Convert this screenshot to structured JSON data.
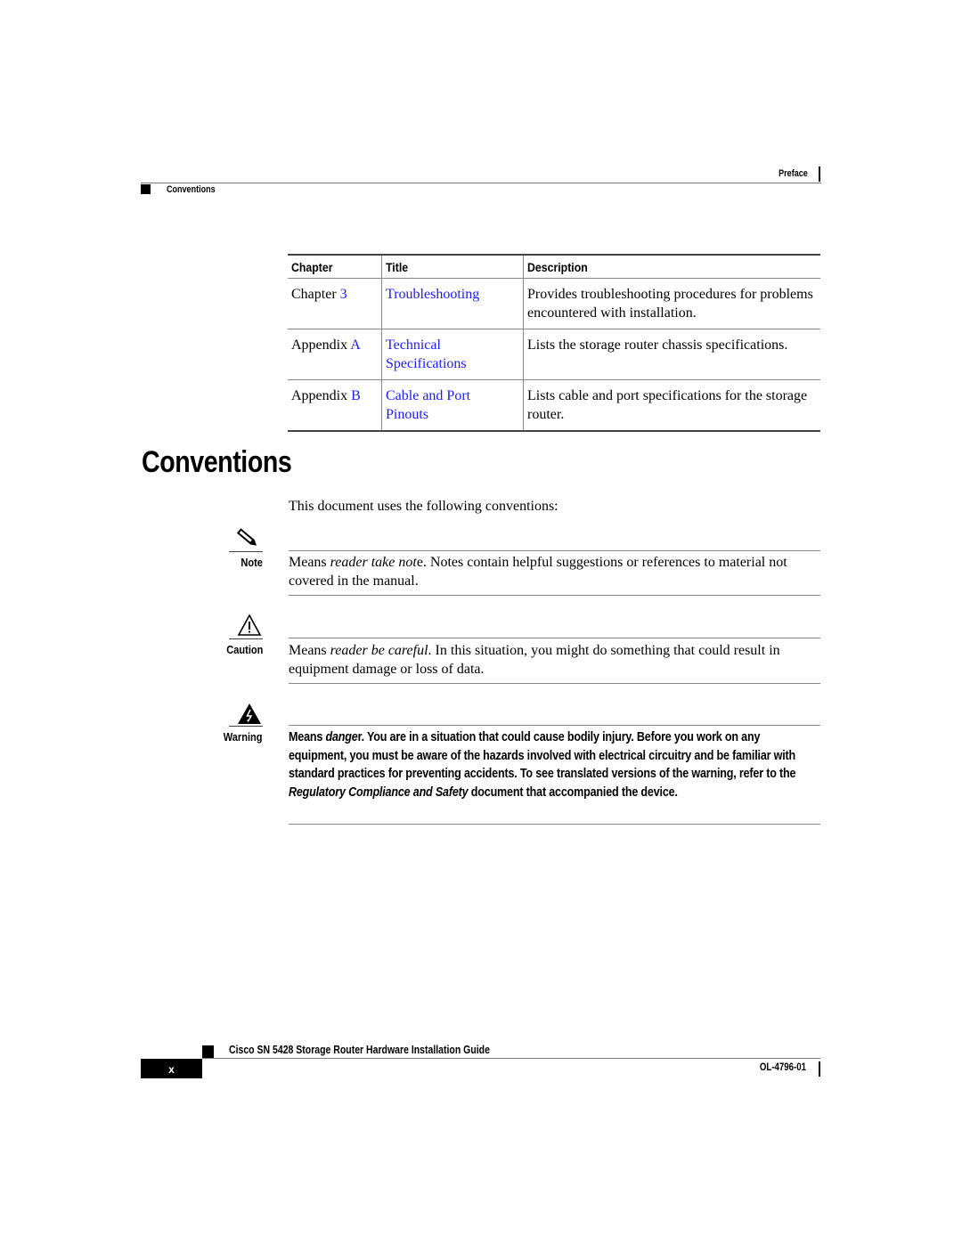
{
  "header": {
    "chapter": "Preface",
    "section": "Conventions"
  },
  "table": {
    "columns": [
      "Chapter",
      "Title",
      "Description"
    ],
    "rows": [
      {
        "chapter_prefix": "Chapter ",
        "chapter_ref": "3",
        "title_line1": "Troubleshooting",
        "title_line2": "",
        "description": "Provides troubleshooting procedures for problems encountered with installation."
      },
      {
        "chapter_prefix": "Appendix ",
        "chapter_ref": "A",
        "title_line1": "Technical",
        "title_line2": "Specifications",
        "description": "Lists the storage router chassis specifications."
      },
      {
        "chapter_prefix": "Appendix ",
        "chapter_ref": "B",
        "title_line1": "Cable and Port",
        "title_line2": "Pinouts",
        "description": "Lists cable and port specifications for the storage router."
      }
    ]
  },
  "section": {
    "heading": "Conventions",
    "intro": "This document uses the following conventions:"
  },
  "admonitions": {
    "note": {
      "label": "Note",
      "icon": "pencil-note-icon",
      "text_before": "Means ",
      "text_italic": "reader take not",
      "text_after": "e. Notes contain helpful suggestions or references to material not covered in the manual."
    },
    "caution": {
      "label": "Caution",
      "icon": "caution-triangle-icon",
      "text_before": "Means ",
      "text_italic": "reader be careful",
      "text_after": ". In this situation, you might do something that could result in equipment damage or loss of data."
    },
    "warning": {
      "label": "Warning",
      "icon": "electrical-hazard-icon",
      "text_before": "Means ",
      "text_italic": "dange",
      "text_mid": "r. You are in a situation that could cause bodily injury. Before you work on any equipment, you must be aware of the hazards involved with electrical circuitry and be familiar with standard practices for preventing accidents. To see translated versions of the warning, refer to the ",
      "text_italic2": "Regulatory Compliance and Safety",
      "text_after": " document that accompanied the device."
    }
  },
  "footer": {
    "guide_title": "Cisco SN 5428 Storage Router Hardware Installation Guide",
    "page_number": "x",
    "doc_number": "OL-4796-01"
  },
  "colors": {
    "link": "#1a1aff",
    "text": "#000000",
    "rule": "#888888"
  }
}
